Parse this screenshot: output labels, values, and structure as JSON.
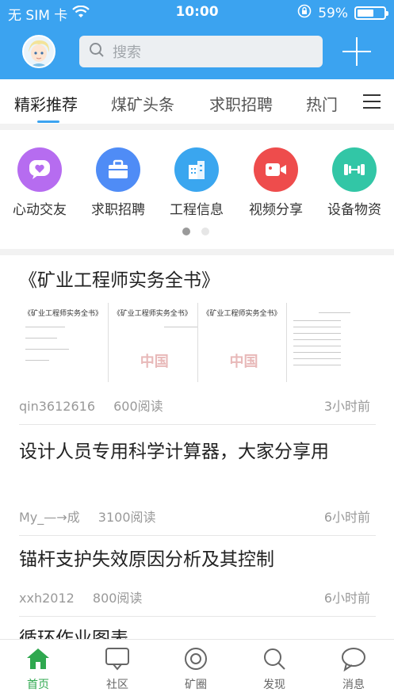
{
  "status_bar": {
    "carrier": "无 SIM 卡",
    "time": "10:00",
    "battery": "59%"
  },
  "header": {
    "search_placeholder": "搜索"
  },
  "tabs": [
    "精彩推荐",
    "煤矿头条",
    "求职招聘",
    "热门"
  ],
  "shortcuts": [
    {
      "label": "心动交友",
      "icon": "heart-chat-icon",
      "color": "#b66cf0"
    },
    {
      "label": "求职招聘",
      "icon": "briefcase-icon",
      "color": "#4f8cf6"
    },
    {
      "label": "工程信息",
      "icon": "building-icon",
      "color": "#3aa6ef"
    },
    {
      "label": "视频分享",
      "icon": "video-camera-icon",
      "color": "#ee4c4c"
    },
    {
      "label": "设备物资",
      "icon": "dumbbell-icon",
      "color": "#32c6a6"
    }
  ],
  "articles": [
    {
      "title": "《矿业工程师实务全书》",
      "author": "qin3612616",
      "reads": "600阅读",
      "time": "3小时前"
    },
    {
      "title": "设计人员专用科学计算器，大家分享用",
      "author": "My_—→成",
      "reads": "3100阅读",
      "time": "6小时前"
    },
    {
      "title": "锚杆支护失效原因分析及其控制",
      "author": "xxh2012",
      "reads": "800阅读",
      "time": "6小时前"
    },
    {
      "title": "循环作业图表",
      "author": "",
      "reads": "",
      "time": ""
    }
  ],
  "doc_thumbs": [
    "《矿业工程师实务全书》",
    "《矿业工程师实务全书》",
    "《矿业工程师实务全书》"
  ],
  "bottom_nav": [
    {
      "label": "首页",
      "icon": "home-icon"
    },
    {
      "label": "社区",
      "icon": "community-icon"
    },
    {
      "label": "矿圈",
      "icon": "circle-icon"
    },
    {
      "label": "发现",
      "icon": "discover-search-icon"
    },
    {
      "label": "消息",
      "icon": "message-bubble-icon"
    }
  ],
  "colors": {
    "brand_blue": "#3ba3f0",
    "active_green": "#2fa84f"
  }
}
